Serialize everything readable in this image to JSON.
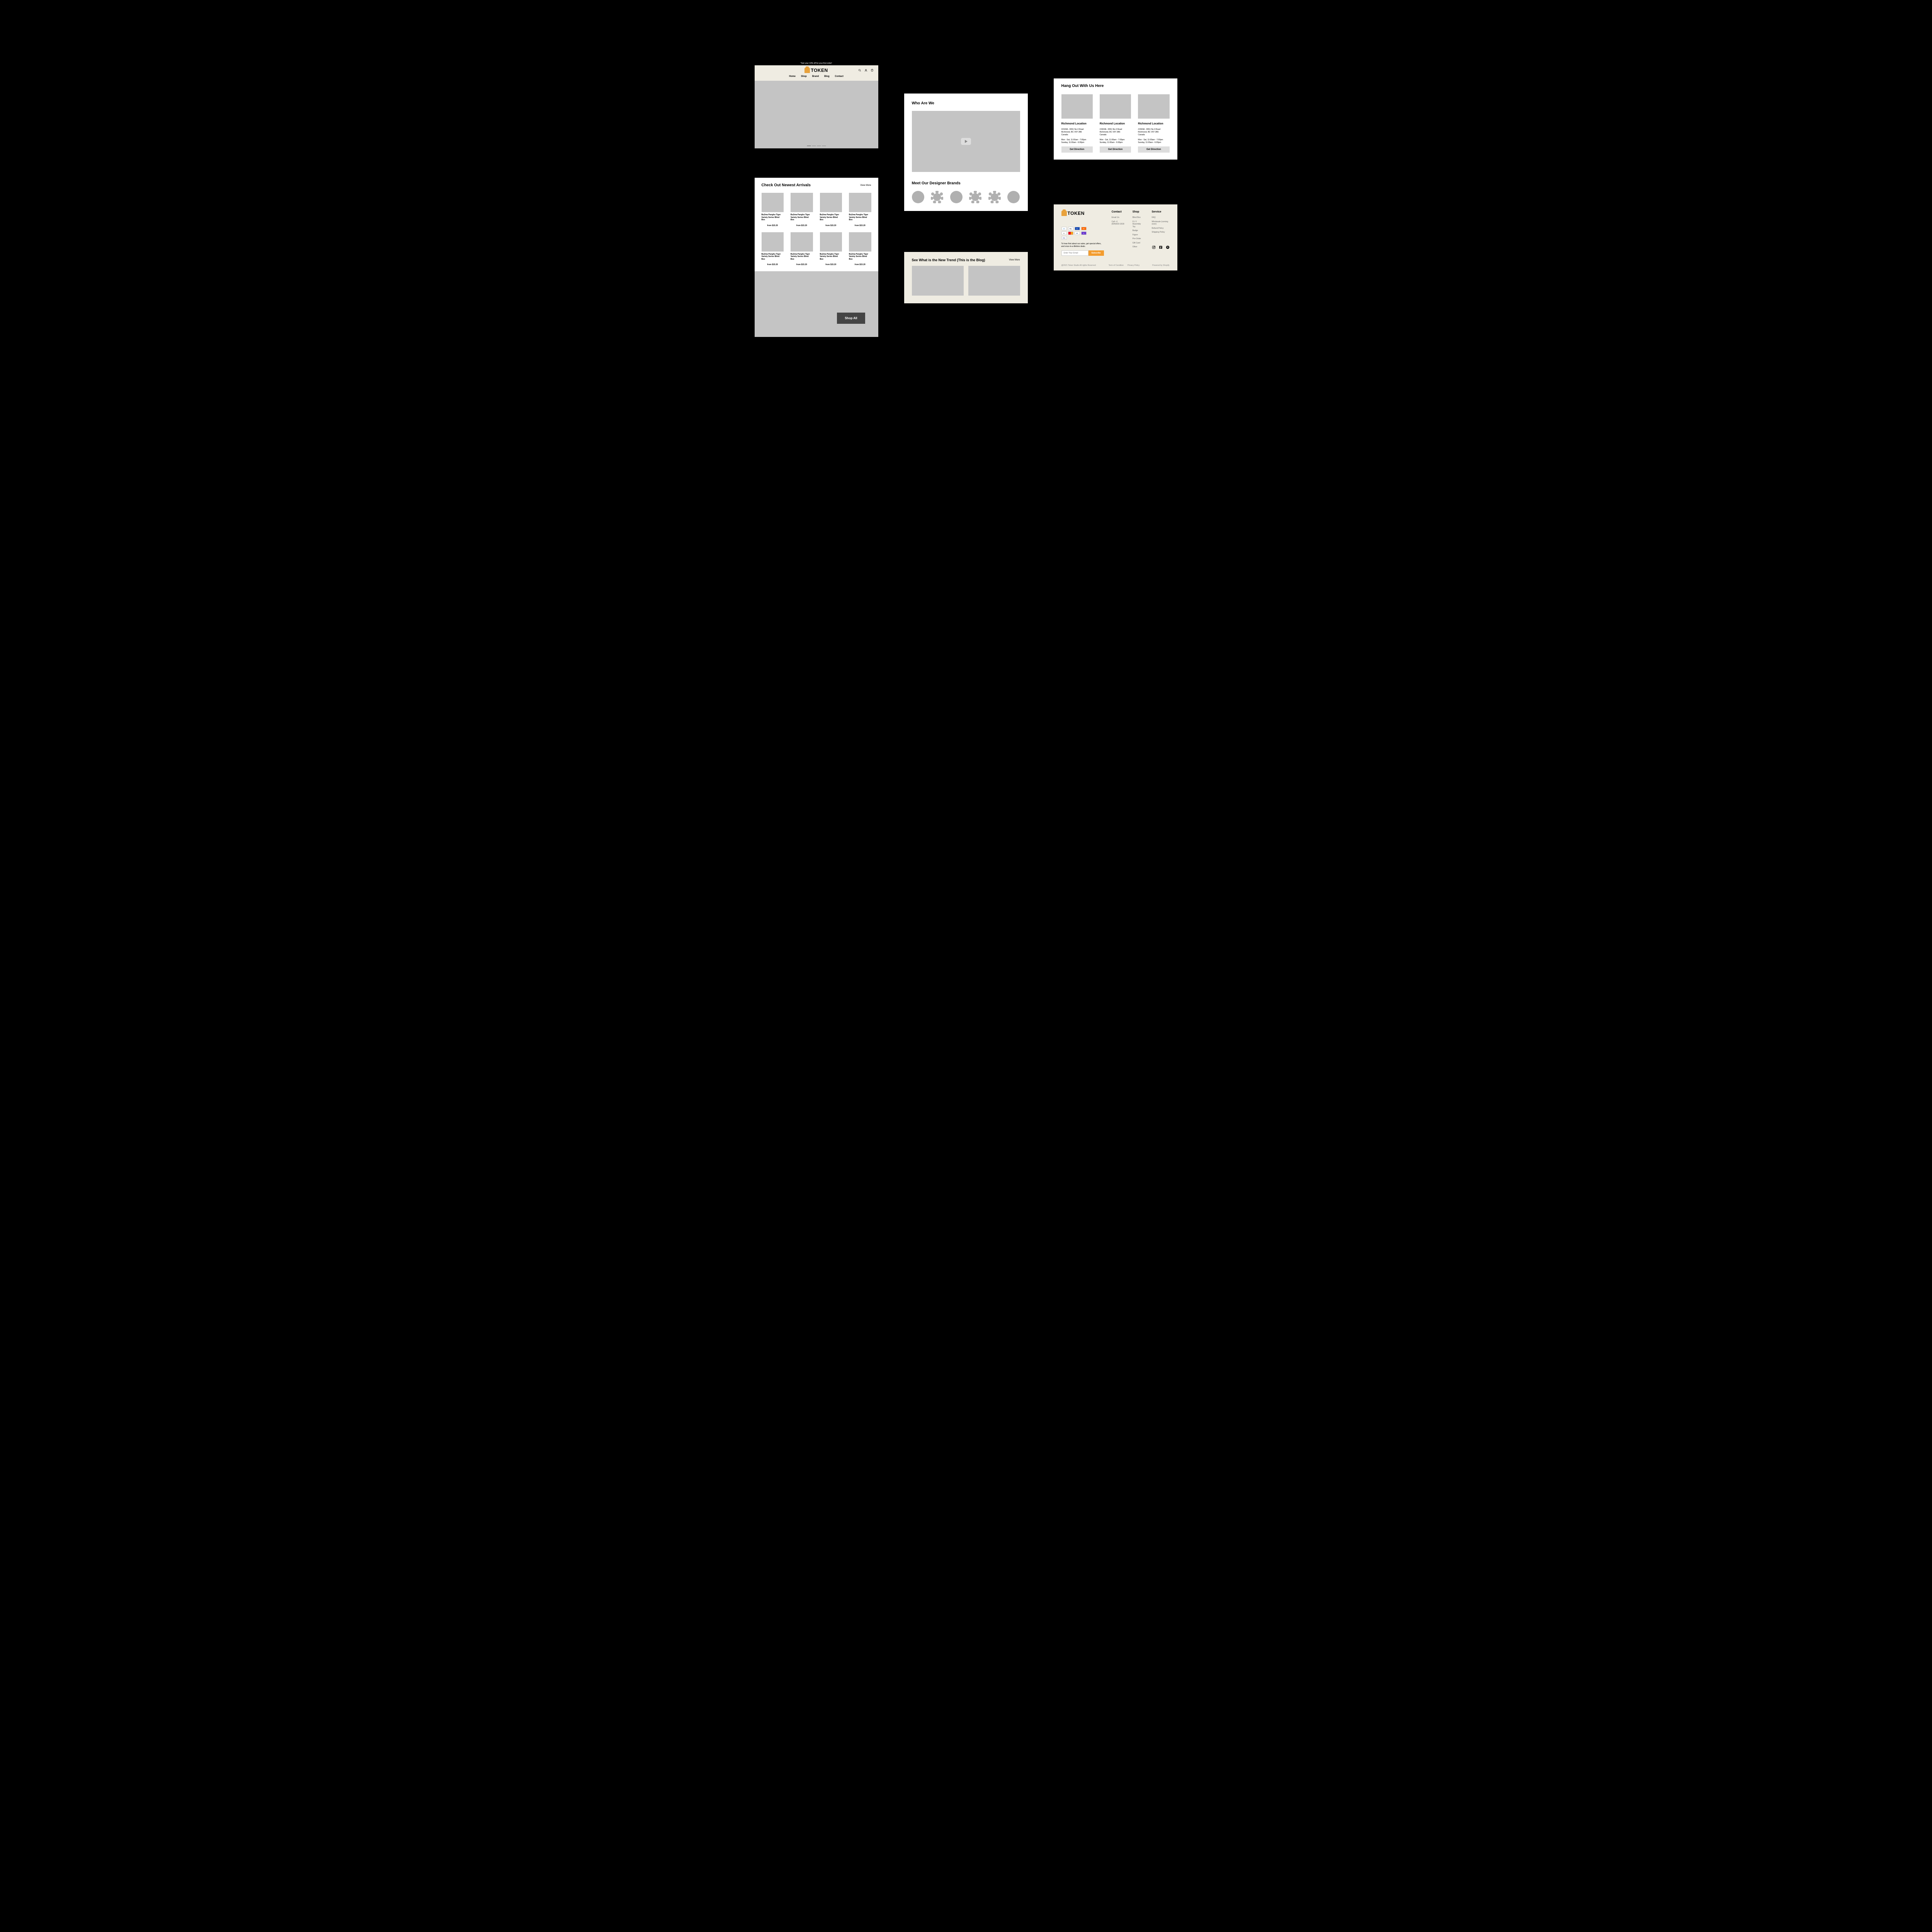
{
  "promo_bar": "*Get your 10% off for your first order!",
  "brand_name": "TOKEN",
  "nav": [
    "Home",
    "Shop",
    "Brand",
    "Blog",
    "Contact"
  ],
  "arrivals": {
    "title": "Check Out Newest Arrivals",
    "view_more": "View More",
    "products": [
      {
        "name": "Bu2ma Panghu Tiger Variety Series Blind Box",
        "price": "from $15.20"
      },
      {
        "name": "Bu2ma Panghu Tiger Variety Series Blind Box",
        "price": "from $15.20"
      },
      {
        "name": "Bu2ma Panghu Tiger Variety Series Blind Box",
        "price": "from $15.20"
      },
      {
        "name": "Bu2ma Panghu Tiger Variety Series Blind Box",
        "price": "from $15.20"
      },
      {
        "name": "Bu2ma Panghu Tiger Variety Series Blind Box",
        "price": "from $15.20"
      },
      {
        "name": "Bu2ma Panghu Tiger Variety Series Blind Box",
        "price": "from $15.20"
      },
      {
        "name": "Bu2ma Panghu Tiger Variety Series Blind Box",
        "price": "from $15.20"
      },
      {
        "name": "Bu2ma Panghu Tiger Variety Series Blind Box",
        "price": "from $15.20"
      }
    ],
    "shop_all": "Shop All"
  },
  "about": {
    "title": "Who Are We",
    "brands_title": "Meet Our Designer Brands"
  },
  "blog": {
    "title": "See What is the New Trend (This is the Blog)",
    "view_more": "View More"
  },
  "locations": {
    "title": "Hang Out With Us Here",
    "items": [
      {
        "name": "Richmond Location",
        "addr1": "#1503A - 6551 No.3 Road",
        "addr2": "Richmond, BC V6Y 2B6",
        "addr3": "Canada",
        "hours1": "Mon - Sat, 11:00am - 7:00pm",
        "hours2": "Sunday, 11:00am - 6:00pm",
        "cta": "Get Direction"
      },
      {
        "name": "Richmond Location",
        "addr1": "#1503A - 6551 No.3 Road",
        "addr2": "Richmond, BC V6Y 2B6",
        "addr3": "Canada",
        "hours1": "Mon - Sat, 11:00am - 7:00pm",
        "hours2": "Sunday, 11:00am - 6:00pm",
        "cta": "Get Direction"
      },
      {
        "name": "Richmond Location",
        "addr1": "#1503A - 6551 No.3 Road",
        "addr2": "Richmond, BC V6Y 2B6",
        "addr3": "Canada",
        "hours1": "Mon - Sat, 11:00am - 7:00pm",
        "hours2": "Sunday, 11:00am - 6:00pm",
        "cta": "Get Direction"
      }
    ]
  },
  "footer": {
    "cols": {
      "contact": {
        "title": "Contact",
        "links": [
          "Email Us",
          "Call +1 (604)503-1818"
        ]
      },
      "shop": {
        "title": "Shop",
        "links": [
          "Blind Box",
          "D.I.Y. Assembly Toy",
          "Badge",
          "Figure",
          "Pre-Order",
          "Gift Card",
          "Other"
        ]
      },
      "service": {
        "title": "Service",
        "links": [
          "FAQ",
          "Wholesale (coming soon)",
          "Refund Policy",
          "Shipping Policy"
        ]
      }
    },
    "newsletter_text": "To hear first about our sales, get special offers, and once-in-a-lifetime deals.",
    "newsletter_placeholder": "Enter Your Email",
    "newsletter_btn": "Subscribe",
    "copyright": "@2021 Token Studio All rights Reserved",
    "legal": [
      "Term of Condition",
      "Privacy Policy"
    ],
    "powered": "Powered by Shopify"
  }
}
